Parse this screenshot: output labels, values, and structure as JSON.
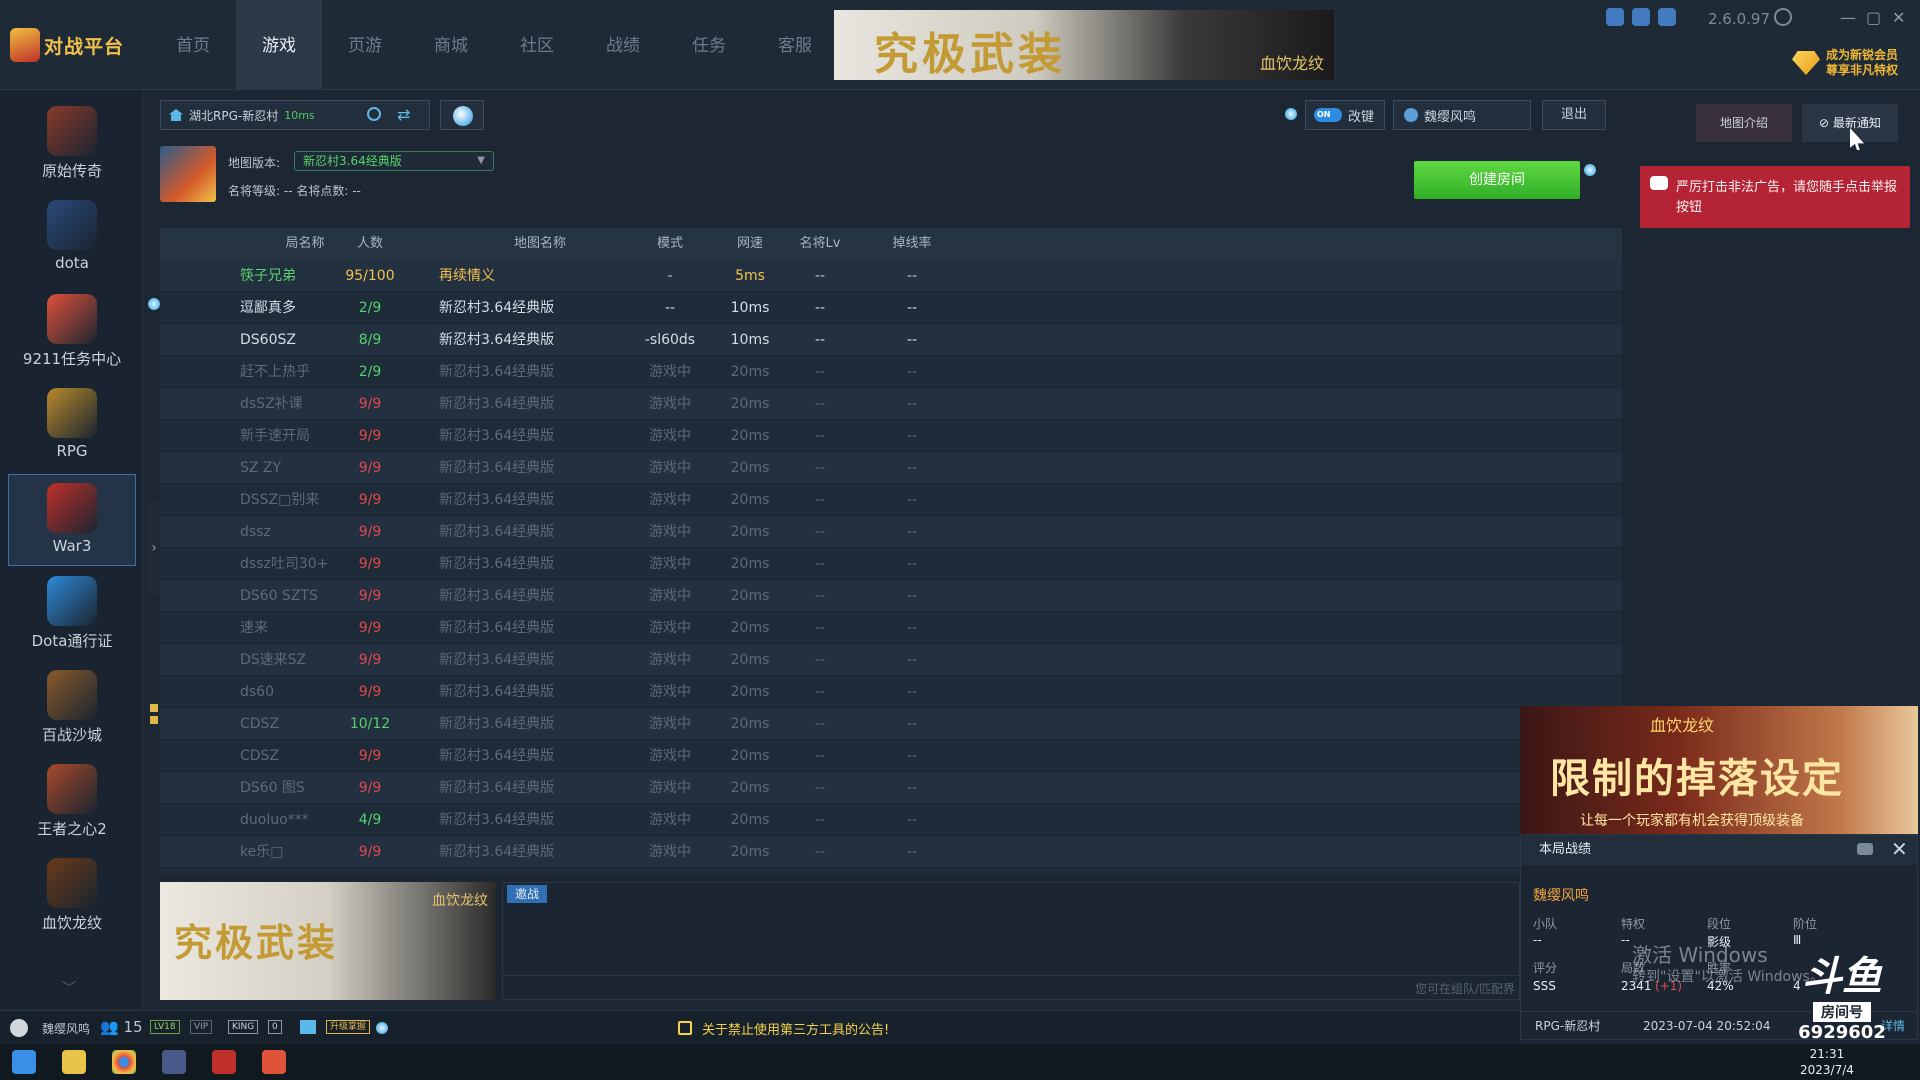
{
  "app": {
    "logo_text": "对战平台",
    "version": "2.6.0.97",
    "vip_promo_line1": "成为新锐会员",
    "vip_promo_line2": "尊享非凡特权"
  },
  "nav": {
    "items": [
      "首页",
      "游戏",
      "页游",
      "商城",
      "社区",
      "战绩",
      "任务",
      "客服"
    ],
    "active": "游戏"
  },
  "top_banner": {
    "title": "究极武装",
    "logo": "血饮龙纹"
  },
  "sidebar": {
    "games": [
      {
        "label": "原始传奇",
        "color": "#8a3a2a"
      },
      {
        "label": "dota",
        "color": "#2a4a7a"
      },
      {
        "label": "9211任务中心",
        "color": "#e0533a"
      },
      {
        "label": "RPG",
        "color": "#b98a2a"
      },
      {
        "label": "War3",
        "color": "#c0302a",
        "active": true
      },
      {
        "label": "Dota通行证",
        "color": "#2e8ad8"
      },
      {
        "label": "百战沙城",
        "color": "#8a5a2a"
      },
      {
        "label": "王者之心2",
        "color": "#a84a2a"
      },
      {
        "label": "血饮龙纹",
        "color": "#6a3a1a"
      }
    ]
  },
  "toolbar": {
    "server_name": "湖北RPG-新忍村",
    "server_ping": "10ms",
    "toggle_state": "ON",
    "toggle_label": "改键",
    "username": "魏缨风鸣",
    "logout_label": "退出"
  },
  "map_info": {
    "version_label": "地图版本:",
    "version_value": "新忍村3.64经典版",
    "rank_line": "名将等级:  --    名将点数:  --"
  },
  "create_room_label": "创建房间",
  "table": {
    "headers": [
      "局名称",
      "人数",
      "地图名称",
      "模式",
      "网速",
      "名将Lv",
      "掉线率"
    ],
    "rows": [
      {
        "name": "筷子兄弟",
        "count": "95/100",
        "map": "再续情义",
        "mode": "-",
        "ping": "5ms",
        "lv": "--",
        "drop": "--",
        "state": "hot"
      },
      {
        "name": "逗鄙真多",
        "count": "2/9",
        "map": "新忍村3.64经典版",
        "mode": "--",
        "ping": "10ms",
        "lv": "--",
        "drop": "--",
        "state": "open"
      },
      {
        "name": "DS60SZ",
        "count": "8/9",
        "map": "新忍村3.64经典版",
        "mode": "-sl60ds",
        "ping": "10ms",
        "lv": "--",
        "drop": "--",
        "state": "open"
      },
      {
        "name": "赶不上热乎",
        "count": "2/9",
        "map": "新忍村3.64经典版",
        "mode": "游戏中",
        "ping": "20ms",
        "lv": "--",
        "drop": "--",
        "state": "playing"
      },
      {
        "name": "dsSZ补课",
        "count": "9/9",
        "map": "新忍村3.64经典版",
        "mode": "游戏中",
        "ping": "20ms",
        "lv": "--",
        "drop": "--",
        "state": "playing"
      },
      {
        "name": "新手速开局",
        "count": "9/9",
        "map": "新忍村3.64经典版",
        "mode": "游戏中",
        "ping": "20ms",
        "lv": "--",
        "drop": "--",
        "state": "playing"
      },
      {
        "name": "SZ ZY",
        "count": "9/9",
        "map": "新忍村3.64经典版",
        "mode": "游戏中",
        "ping": "20ms",
        "lv": "--",
        "drop": "--",
        "state": "playing"
      },
      {
        "name": "DSSZ□别来",
        "count": "9/9",
        "map": "新忍村3.64经典版",
        "mode": "游戏中",
        "ping": "20ms",
        "lv": "--",
        "drop": "--",
        "state": "playing"
      },
      {
        "name": "dssz",
        "count": "9/9",
        "map": "新忍村3.64经典版",
        "mode": "游戏中",
        "ping": "20ms",
        "lv": "--",
        "drop": "--",
        "state": "playing"
      },
      {
        "name": "dssz吐司30+",
        "count": "9/9",
        "map": "新忍村3.64经典版",
        "mode": "游戏中",
        "ping": "20ms",
        "lv": "--",
        "drop": "--",
        "state": "playing"
      },
      {
        "name": "DS60 SZTS",
        "count": "9/9",
        "map": "新忍村3.64经典版",
        "mode": "游戏中",
        "ping": "20ms",
        "lv": "--",
        "drop": "--",
        "state": "playing"
      },
      {
        "name": "速来",
        "count": "9/9",
        "map": "新忍村3.64经典版",
        "mode": "游戏中",
        "ping": "20ms",
        "lv": "--",
        "drop": "--",
        "state": "playing"
      },
      {
        "name": "DS速来SZ",
        "count": "9/9",
        "map": "新忍村3.64经典版",
        "mode": "游戏中",
        "ping": "20ms",
        "lv": "--",
        "drop": "--",
        "state": "playing"
      },
      {
        "name": "ds60",
        "count": "9/9",
        "map": "新忍村3.64经典版",
        "mode": "游戏中",
        "ping": "20ms",
        "lv": "--",
        "drop": "--",
        "state": "playing"
      },
      {
        "name": "CDSZ",
        "count": "10/12",
        "map": "新忍村3.64经典版",
        "mode": "游戏中",
        "ping": "20ms",
        "lv": "--",
        "drop": "--",
        "state": "playing"
      },
      {
        "name": "CDSZ",
        "count": "9/9",
        "map": "新忍村3.64经典版",
        "mode": "游戏中",
        "ping": "20ms",
        "lv": "--",
        "drop": "--",
        "state": "playing"
      },
      {
        "name": "DS60 图S",
        "count": "9/9",
        "map": "新忍村3.64经典版",
        "mode": "游戏中",
        "ping": "20ms",
        "lv": "--",
        "drop": "--",
        "state": "playing"
      },
      {
        "name": "duoluo***",
        "count": "4/9",
        "map": "新忍村3.64经典版",
        "mode": "游戏中",
        "ping": "20ms",
        "lv": "--",
        "drop": "--",
        "state": "playing"
      },
      {
        "name": "ke乐□",
        "count": "9/9",
        "map": "新忍村3.64经典版",
        "mode": "游戏中",
        "ping": "20ms",
        "lv": "--",
        "drop": "--",
        "state": "playing"
      }
    ]
  },
  "chat": {
    "tab_label": "邀战",
    "hint": "您可在组队/匹配界"
  },
  "right_panel": {
    "tabs": [
      "地图介绍",
      "最新通知"
    ],
    "notice": "严厉打击非法广告，请您随手点击举报按钮"
  },
  "ad": {
    "logo": "血饮龙纹",
    "title": "限制的掉落设定",
    "subtitle": "让每一个玩家都有机会获得顶级装备"
  },
  "stats": {
    "title": "本局战绩",
    "username": "魏缨风鸣",
    "labels": [
      "小队",
      "特权",
      "段位",
      "阶位"
    ],
    "values": [
      "--",
      "--",
      "影级",
      "Ⅲ"
    ],
    "labels2": [
      "评分",
      "局数",
      "胜率",
      ""
    ],
    "values2": [
      "SSS",
      "2341",
      "42%",
      "4"
    ],
    "win_delta": "(+1)",
    "footer_room": "RPG-新忍村",
    "footer_time": "2023-07-04 20:52:04",
    "footer_link": "详情"
  },
  "watermark": {
    "line1": "激活 Windows",
    "line2": "转到\"设置\"以激活 Windows。"
  },
  "douyu": {
    "logo": "斗鱼",
    "tag": "房间号",
    "room": "6929602"
  },
  "statusbar": {
    "username": "魏缨风鸣",
    "friends": "15",
    "badges": [
      "LV18",
      "VIP",
      "KING",
      "0",
      "升级掌握"
    ],
    "notice": "关于禁止使用第三方工具的公告!"
  },
  "taskbar": {
    "time": "21:31",
    "date": "2023/7/4"
  }
}
